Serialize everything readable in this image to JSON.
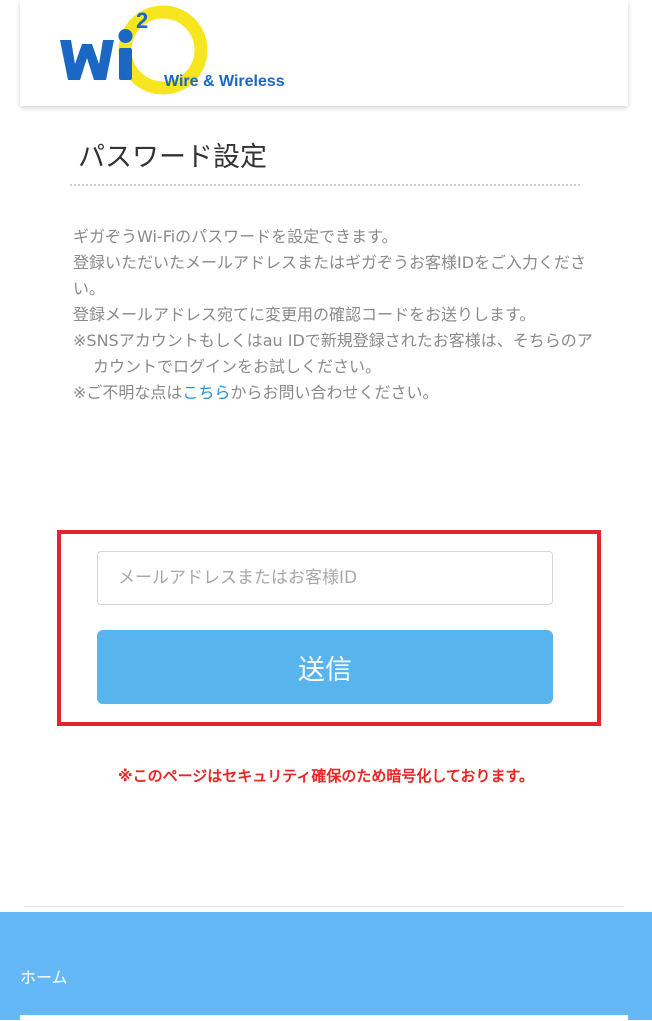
{
  "header": {
    "logo_text": "Wire & Wireless",
    "logo_colors": {
      "ring": "#f7e51f",
      "letters": "#1a67c4"
    }
  },
  "page": {
    "title": "パスワード設定",
    "description": [
      "ギガぞうWi-Fiのパスワードを設定できます。",
      "登録いただいたメールアドレスまたはギガぞうお客様IDをご入力ください。",
      "登録メールアドレス宛てに変更用の確認コードをお送りします。",
      "※SNSアカウントもしくはau IDで新規登録されたお客様は、そちらのアカウントでログインをお試しください。"
    ],
    "inquiry": {
      "prefix": "※ご不明な点は",
      "link": "こちら",
      "suffix": "からお問い合わせください。"
    }
  },
  "form": {
    "email_placeholder": "メールアドレスまたはお客様ID",
    "email_value": "",
    "submit_label": "送信"
  },
  "security_note": "※このページはセキュリティ確保のため暗号化しております。",
  "footer": {
    "home_label": "ホーム"
  },
  "colors": {
    "accent": "#57b4ec",
    "highlight_border": "#e0252f",
    "warning_text": "#ec2424",
    "footer_bg": "#64b8f7",
    "link": "#2a8fd8"
  }
}
